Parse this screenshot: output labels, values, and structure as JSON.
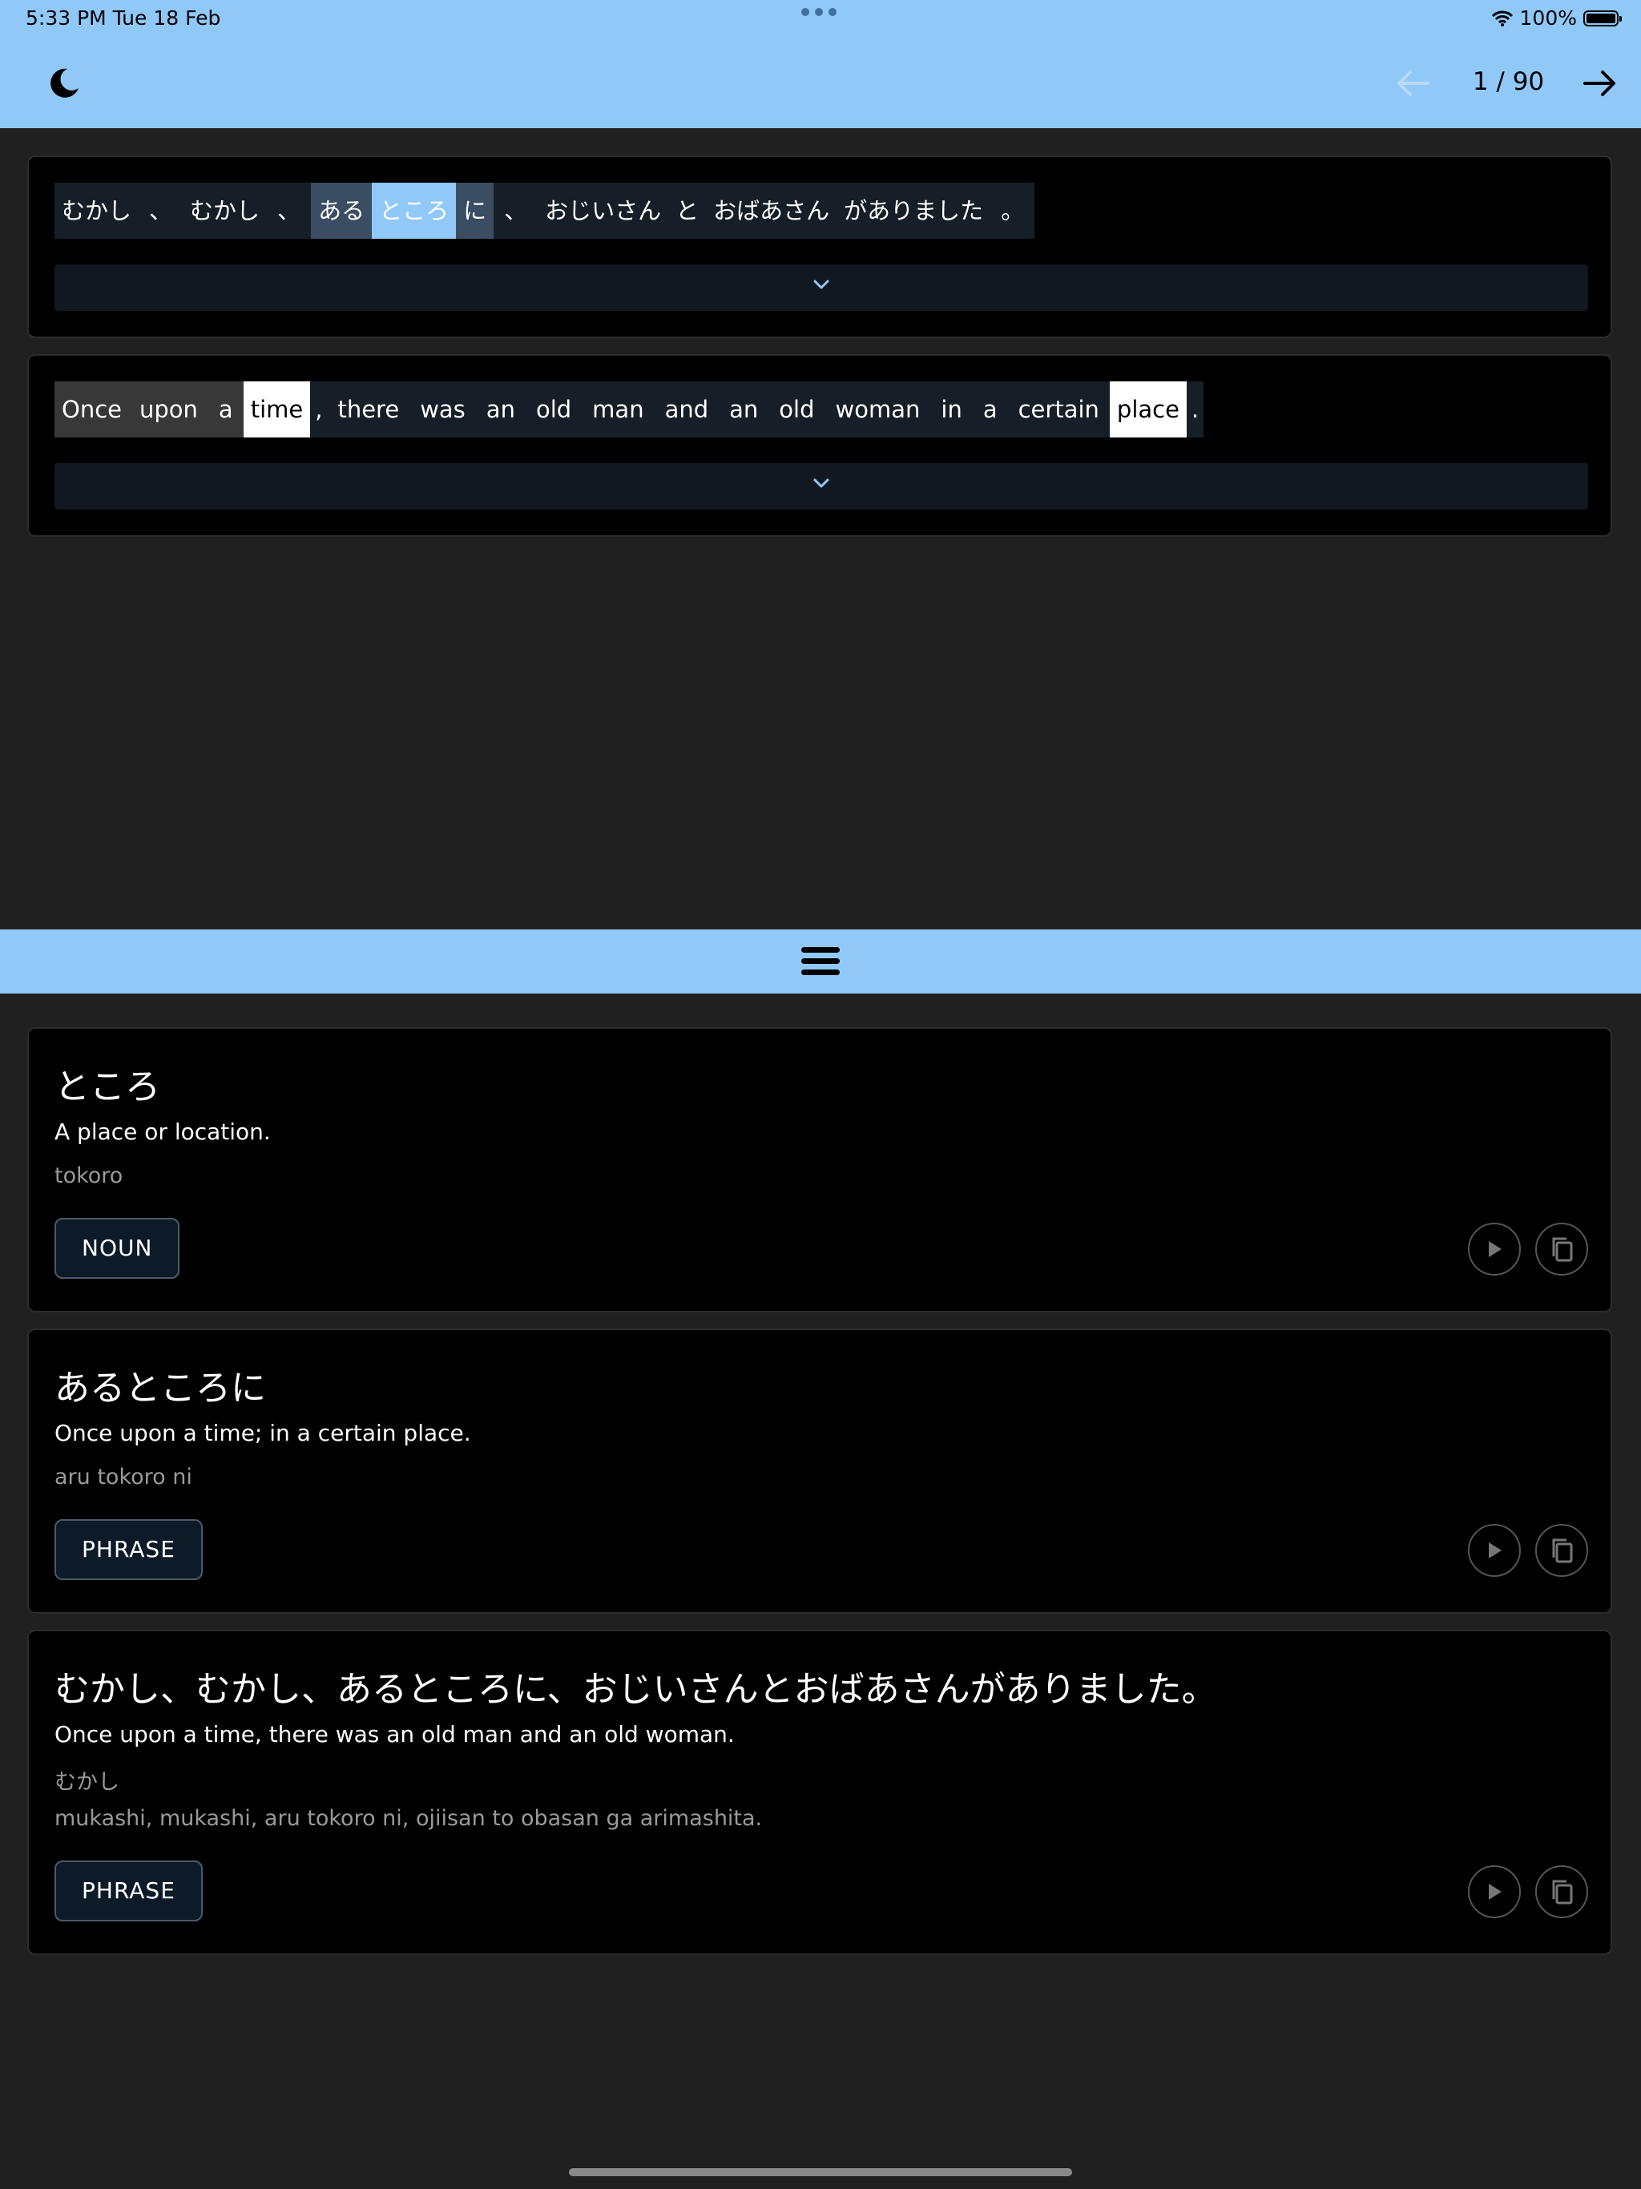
{
  "status_bar": {
    "time": "5:33 PM",
    "date": "Tue 18 Feb",
    "battery": "100%"
  },
  "toolbar": {
    "counter": "1 / 90"
  },
  "sentence_jp": {
    "tokens": [
      "むかし",
      "、",
      "むかし",
      "、",
      "ある",
      "ところ",
      "に",
      "、",
      "おじいさん",
      "と",
      "おばあさん",
      "がありました",
      "。"
    ]
  },
  "sentence_en": {
    "tokens": [
      "Once",
      "upon",
      "a",
      "time",
      ",",
      "there",
      "was",
      "an",
      "old",
      "man",
      "and",
      "an",
      "old",
      "woman",
      "in",
      "a",
      "certain",
      "place",
      "."
    ]
  },
  "entries": [
    {
      "title": "ところ",
      "definition": "A place or location.",
      "reading": "tokoro",
      "tag": "NOUN"
    },
    {
      "title": "あるところに",
      "definition": "Once upon a time; in a certain place.",
      "reading": "aru tokoro ni",
      "tag": "PHRASE"
    },
    {
      "title": "むかし、むかし、あるところに、おじいさんとおばあさんがありました。",
      "definition": "Once upon a time, there was an old man and an old woman.",
      "furigana": "むかし",
      "reading": "mukashi, mukashi, aru tokoro ni, ojiisan to obasan ga arimashita.",
      "tag": "PHRASE"
    }
  ],
  "colors": {
    "accent": "#90c8f8",
    "background": "#202020",
    "card": "#000000"
  },
  "icons": [
    "moon-icon",
    "arrow-left-icon",
    "arrow-right-icon",
    "chevron-down-icon",
    "menu-icon",
    "play-icon",
    "copy-icon",
    "wifi-icon",
    "battery-icon"
  ]
}
